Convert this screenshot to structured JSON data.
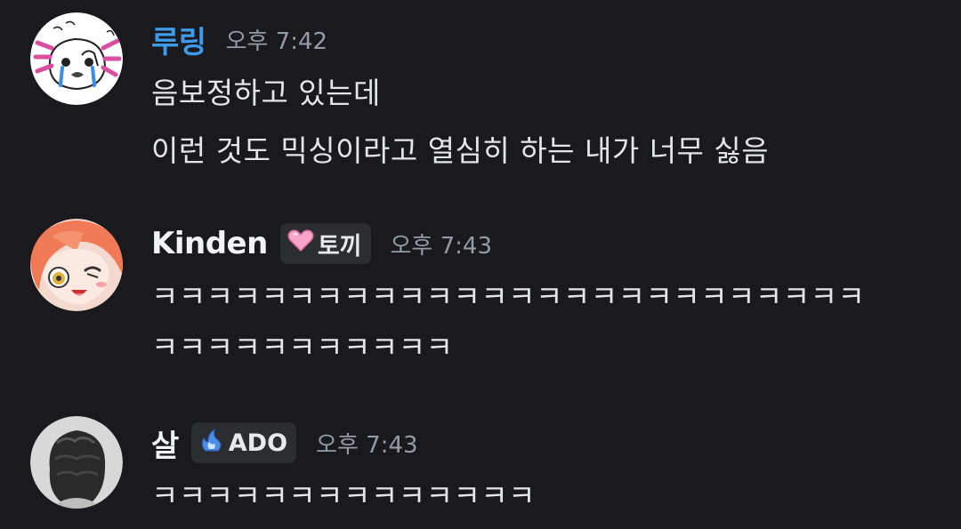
{
  "messages": [
    {
      "username": "루링",
      "username_color": "#3d9be9",
      "timestamp": "오후 7:42",
      "lines": [
        "음보정하고 있는데",
        "이런 것도 믹싱이라고 열심히 하는 내가 너무 싫음"
      ]
    },
    {
      "username": "Kinden",
      "username_color": "#f2f3f5",
      "badge": {
        "icon": "pink-heart-icon",
        "label": "토끼"
      },
      "timestamp": "오후 7:43",
      "lines": [
        "ㅋㅋㅋㅋㅋㅋㅋㅋㅋㅋㅋㅋㅋㅋㅋㅋㅋㅋㅋㅋㅋㅋㅋㅋㅋㅋ",
        "ㅋㅋㅋㅋㅋㅋㅋㅋㅋㅋㅋ"
      ]
    },
    {
      "username": "살",
      "username_color": "#f2f3f5",
      "badge": {
        "icon": "blue-flame-icon",
        "label": "ADO"
      },
      "timestamp": "오후 7:43",
      "lines": [
        "ㅋㅋㅋㅋㅋㅋㅋㅋㅋㅋㅋㅋㅋㅋ"
      ]
    }
  ]
}
